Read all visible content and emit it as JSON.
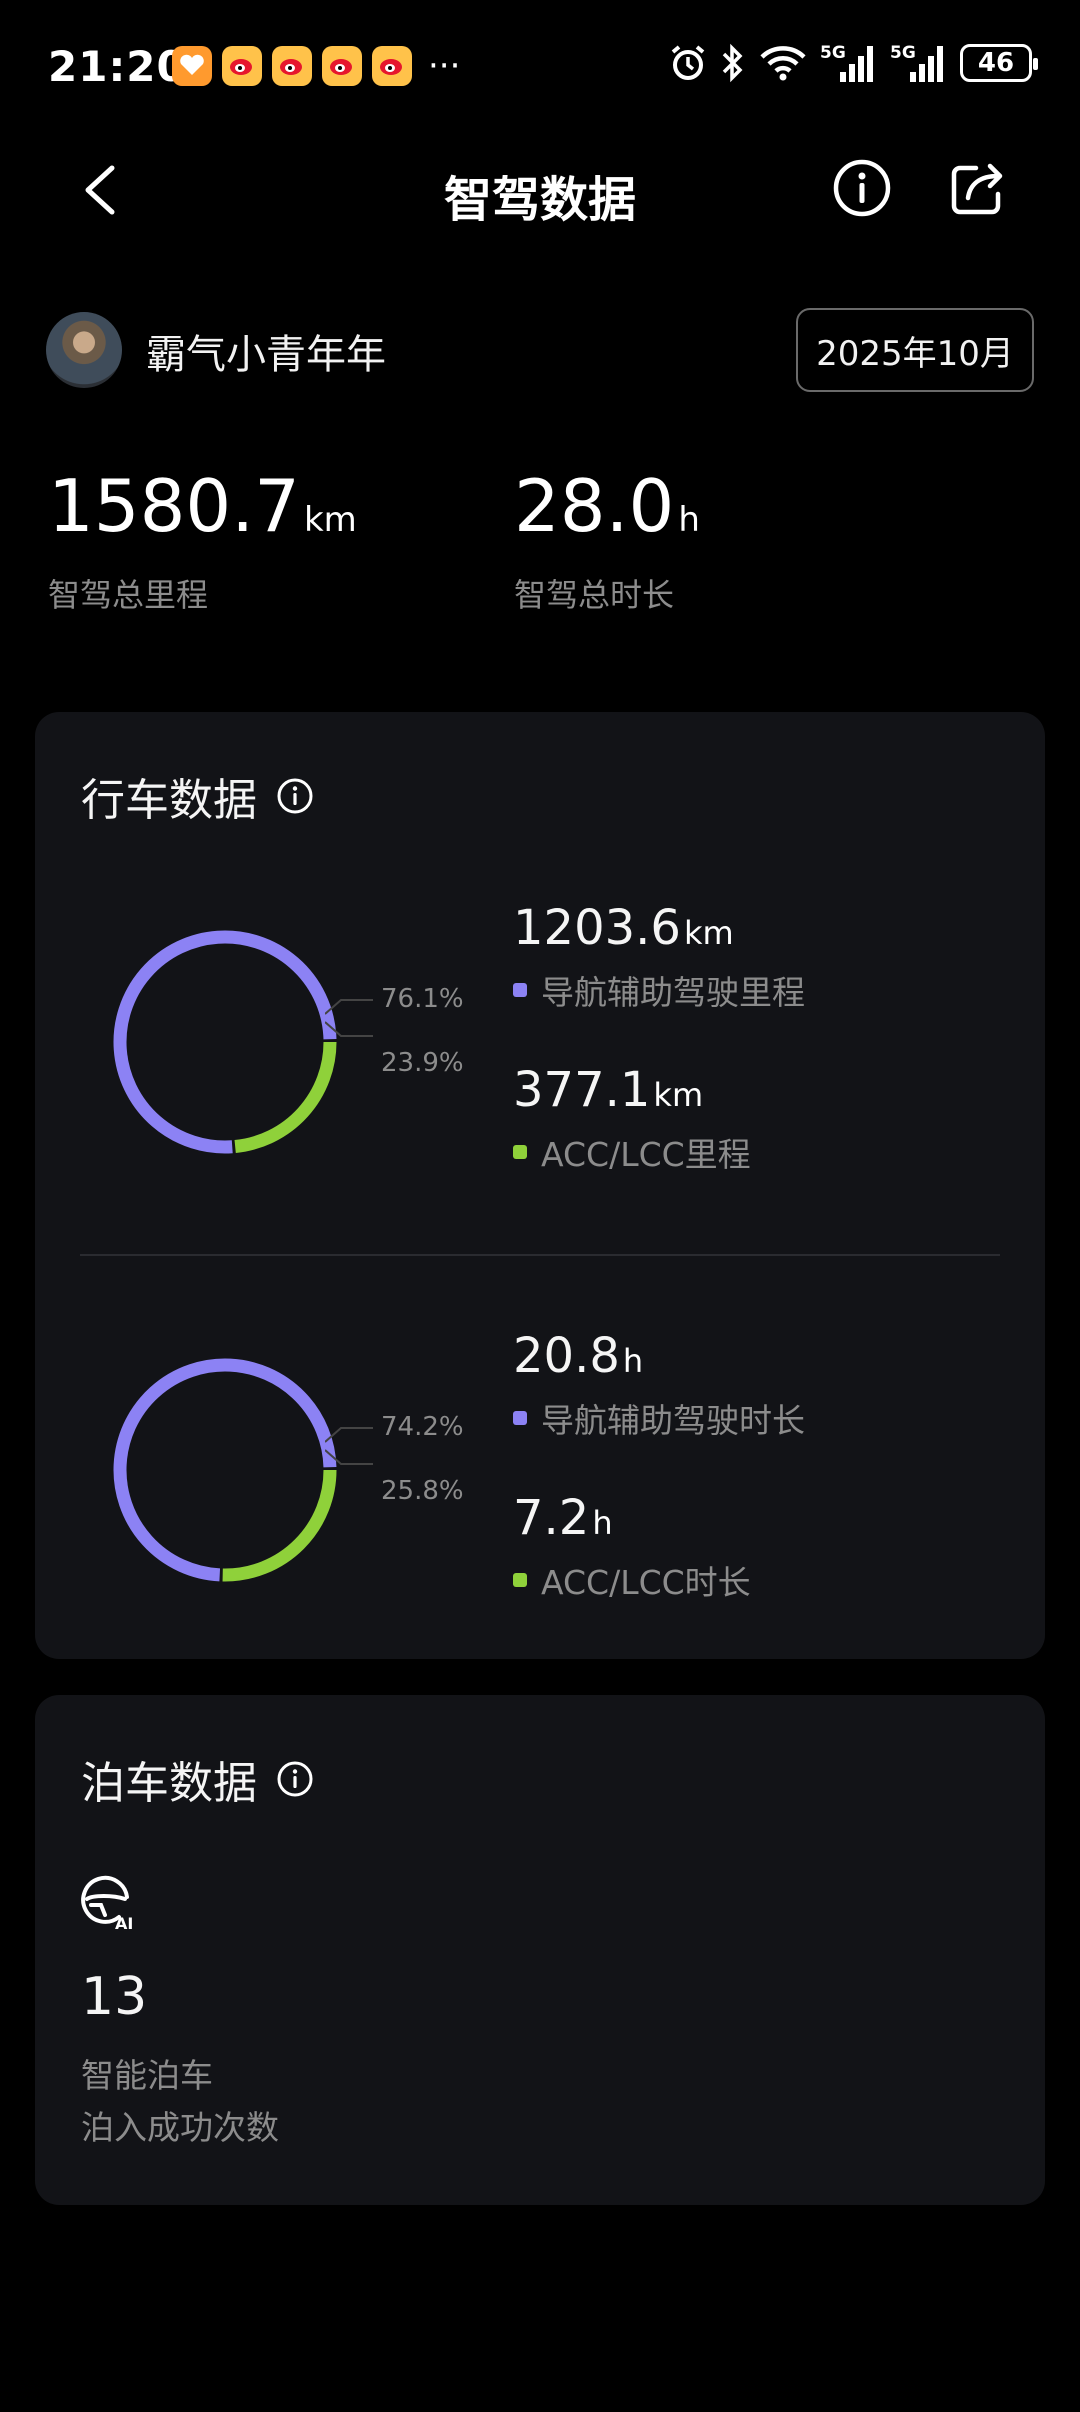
{
  "status_bar": {
    "time": "21:20",
    "more": "···",
    "network_1": "5G",
    "network_2": "5G",
    "battery": "46",
    "icons": [
      "heart-app-icon",
      "weibo-icon",
      "weibo-icon",
      "weibo-icon",
      "weibo-icon",
      "alarm-icon",
      "bluetooth-icon",
      "wifi-icon",
      "signal-icon",
      "signal-icon",
      "battery-icon"
    ]
  },
  "nav": {
    "title": "智驾数据"
  },
  "profile": {
    "username": "霸气小青年年",
    "month": "2025年10月"
  },
  "totals": {
    "mileage_value": "1580.7",
    "mileage_unit": "km",
    "mileage_label": "智驾总里程",
    "duration_value": "28.0",
    "duration_unit": "h",
    "duration_label": "智驾总时长"
  },
  "driving": {
    "title": "行车数据",
    "mileage": {
      "nav_pct": "76.1%",
      "acc_pct": "23.9%",
      "nav_fraction": 0.761,
      "nav_value": "1203.6",
      "nav_unit": "km",
      "nav_label": "导航辅助驾驶里程",
      "acc_value": "377.1",
      "acc_unit": "km",
      "acc_label": "ACC/LCC里程"
    },
    "duration": {
      "nav_pct": "74.2%",
      "acc_pct": "25.8%",
      "nav_fraction": 0.742,
      "nav_value": "20.8",
      "nav_unit": "h",
      "nav_label": "导航辅助驾驶时长",
      "acc_value": "7.2",
      "acc_unit": "h",
      "acc_label": "ACC/LCC时长"
    }
  },
  "parking": {
    "title": "泊车数据",
    "count": "13",
    "label_1": "智能泊车",
    "label_2": "泊入成功次数"
  },
  "colors": {
    "nav_series": "#8c82f4",
    "acc_series": "#8fd13a",
    "background": "#000000",
    "card": "#121317"
  }
}
